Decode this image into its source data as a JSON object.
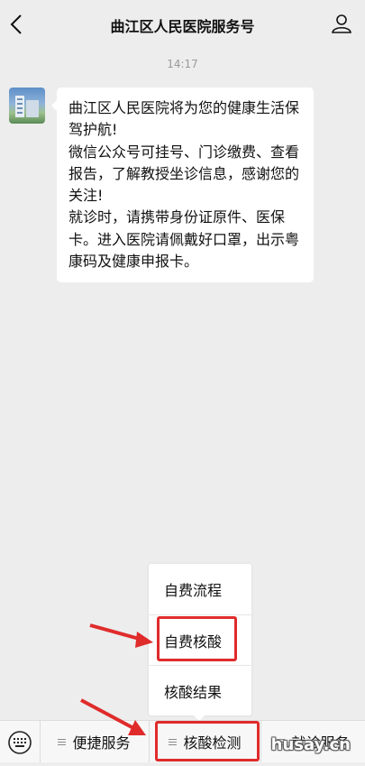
{
  "header": {
    "title": "曲江区人民医院服务号",
    "back_icon": "chevron-left-icon",
    "profile_icon": "person-icon"
  },
  "chat": {
    "time": "14:17",
    "message": {
      "paragraphs": [
        "曲江区人民医院将为您的健康生活保驾护航!",
        "微信公众号可挂号、门诊缴费、查看报告，了解教授坐诊信息，感谢您的关注!",
        "就诊时，请携带身份证原件、医保卡。进入医院请佩戴好口罩，出示粤康码及健康申报卡。"
      ]
    }
  },
  "submenu": {
    "items": [
      {
        "label": "自费流程"
      },
      {
        "label": "自费核酸"
      },
      {
        "label": "核酸结果"
      }
    ]
  },
  "bottom_menu": {
    "keyboard_icon": "keyboard-icon",
    "items": [
      {
        "label": "便捷服务"
      },
      {
        "label": "核酸检测"
      },
      {
        "label": "就诊服务"
      }
    ]
  },
  "annotations": {
    "highlight_color": "#e02b2b"
  },
  "watermark": "husay.cn"
}
